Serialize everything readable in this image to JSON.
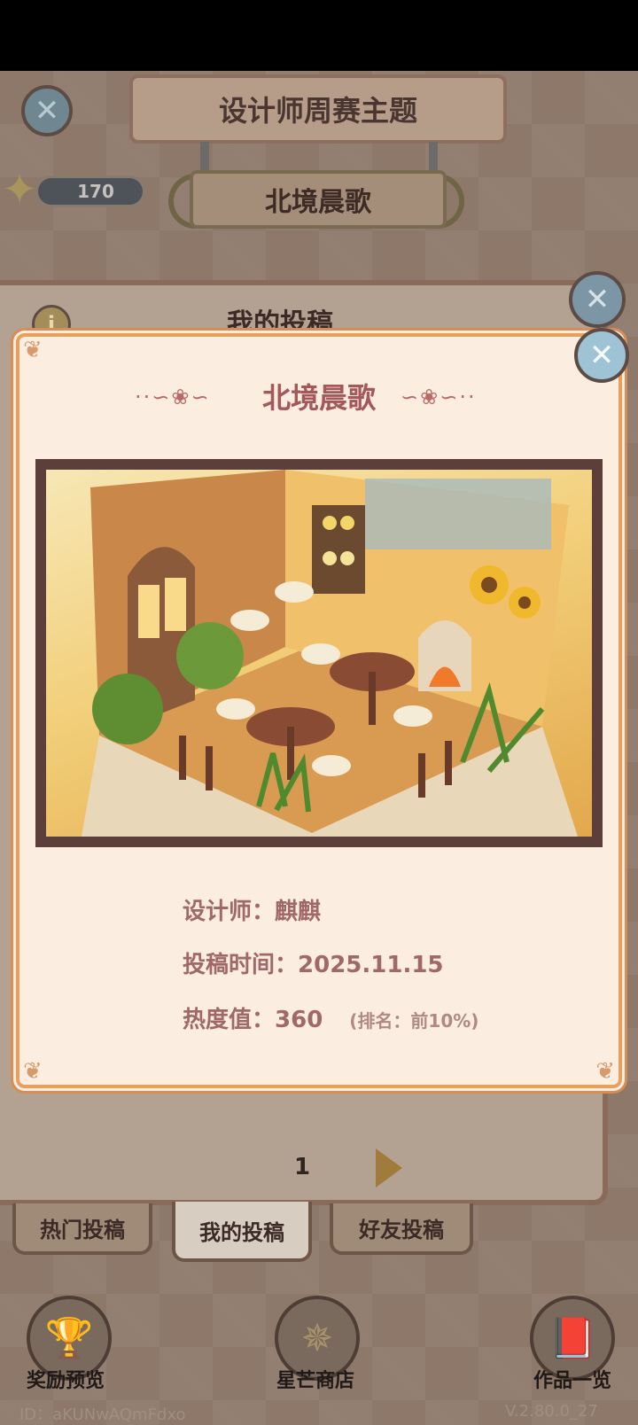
{
  "header": {
    "theme_title": "设计师周赛主题",
    "theme_name": "北境晨歌",
    "star_count": "170"
  },
  "back_panel": {
    "title": "我的投稿",
    "page_number": "1",
    "tabs": [
      "热门投稿",
      "我的投稿",
      "好友投稿"
    ]
  },
  "bottom_nav": {
    "items": [
      "奖励预览",
      "星芒商店",
      "作品一览"
    ]
  },
  "footer": {
    "user_id": "ID：aKUNwAQmFdxo",
    "version": "V.2.80.0_27"
  },
  "card": {
    "title": "北境晨歌",
    "designer_label": "设计师：",
    "designer_value": "麒麒",
    "time_label": "投稿时间：",
    "time_value": "2025.11.15",
    "heat_label": "热度值：",
    "heat_value": "360",
    "rank_text": "(排名：前10%)"
  }
}
